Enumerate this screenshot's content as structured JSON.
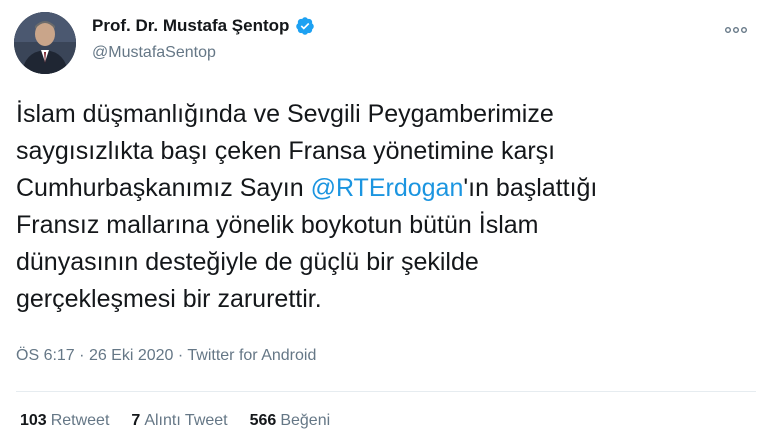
{
  "author": {
    "name": "Prof. Dr. Mustafa Şentop",
    "handle": "@MustafaSentop",
    "verified": true,
    "avatar_icon": "profile-photo"
  },
  "menu_icon": "more-options-icon",
  "tweet": {
    "lines": [
      {
        "before": "İslam düşmanlığında ve Sevgili Peygamberimize",
        "mention": "",
        "after": ""
      },
      {
        "before": "saygısızlıkta başı çeken Fransa yönetimine karşı",
        "mention": "",
        "after": ""
      },
      {
        "before": "Cumhurbaşkanımız Sayın ",
        "mention": "@RTErdogan",
        "after": "'ın başlattığı"
      },
      {
        "before": "Fransız mallarına yönelik boykotun bütün İslam",
        "mention": "",
        "after": ""
      },
      {
        "before": "dünyasının desteğiyle de güçlü bir şekilde",
        "mention": "",
        "after": ""
      },
      {
        "before": "gerçekleşmesi bir zarurettir.",
        "mention": "",
        "after": ""
      }
    ]
  },
  "meta": {
    "time": "ÖS 6:17",
    "separator": "·",
    "date": "26 Eki 2020",
    "source": "Twitter for Android"
  },
  "stats": {
    "retweets": {
      "count": "103",
      "label": "Retweet"
    },
    "quotes": {
      "count": "7",
      "label": "Alıntı Tweet"
    },
    "likes": {
      "count": "566",
      "label": "Beğeni"
    }
  },
  "colors": {
    "link": "#1b95e0",
    "verified": "#1da1f2",
    "muted": "#657786",
    "text": "#14171a"
  }
}
